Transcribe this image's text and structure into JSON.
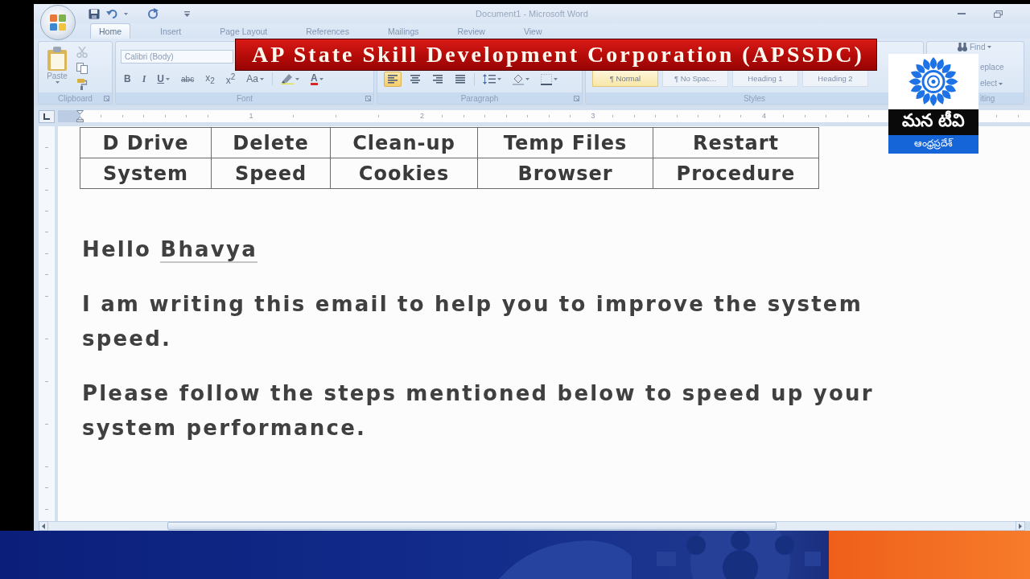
{
  "window": {
    "title": "Document1 - Microsoft Word"
  },
  "ribbon_tabs": [
    {
      "label": "Home",
      "selected": true
    },
    {
      "label": "Insert",
      "selected": false
    },
    {
      "label": "Page Layout",
      "selected": false
    },
    {
      "label": "References",
      "selected": false
    },
    {
      "label": "Mailings",
      "selected": false
    },
    {
      "label": "Review",
      "selected": false
    },
    {
      "label": "View",
      "selected": false
    }
  ],
  "ribbon": {
    "clipboard": {
      "paste": "Paste",
      "label": "Clipboard"
    },
    "font": {
      "font_name": "Calibri (Body)",
      "format_buttons": [
        {
          "kind": "bold",
          "label": "B"
        },
        {
          "kind": "italic",
          "label": "I"
        },
        {
          "kind": "underline",
          "label": "U"
        },
        {
          "kind": "strikethrough",
          "label": "abc"
        },
        {
          "kind": "subscript",
          "label": "x$_{2}$"
        },
        {
          "kind": "superscript",
          "label": "x$^{2}$"
        },
        {
          "kind": "change_case",
          "label": "Aa"
        },
        {
          "kind": "highlight"
        },
        {
          "kind": "font_color",
          "label": "A"
        }
      ],
      "label": "Font"
    },
    "paragraph": {
      "alignment": [
        {
          "kind": "left",
          "selected": true
        },
        {
          "kind": "center",
          "selected": false
        },
        {
          "kind": "right",
          "selected": false
        },
        {
          "kind": "justify",
          "selected": false
        }
      ],
      "label": "Paragraph"
    },
    "styles": {
      "items": [
        {
          "label": "¶ Normal",
          "selected": true
        },
        {
          "label": "¶ No Spac...",
          "selected": false
        },
        {
          "label": "Heading 1",
          "selected": false
        },
        {
          "label": "Heading 2",
          "selected": false
        }
      ],
      "label": "Styles"
    },
    "editing": {
      "find": "Find",
      "replace": "eplace",
      "select": "elect",
      "label": "iting"
    }
  },
  "banner": {
    "text": "AP State Skill Development Corporation (APSSDC)"
  },
  "channel_logo": {
    "name": "మన టీవి",
    "region": "ఆంధ్రప్రదేశ్"
  },
  "ruler": {
    "marks": [
      "1",
      "2",
      "3",
      "4"
    ]
  },
  "document": {
    "table": {
      "rows": [
        [
          "D Drive",
          "Delete",
          "Clean-up",
          "Temp Files",
          "Restart"
        ],
        [
          "System",
          "Speed",
          "Cookies",
          "Browser",
          "Procedure"
        ]
      ]
    },
    "greeting": [
      {
        "text": "Hello",
        "flagged": false
      },
      {
        "text": "Bhavya",
        "flagged": true
      }
    ],
    "paragraphs": [
      "I am writing this email to help you to improve the system speed.",
      "Please follow the steps mentioned below to speed up your system performance."
    ]
  }
}
